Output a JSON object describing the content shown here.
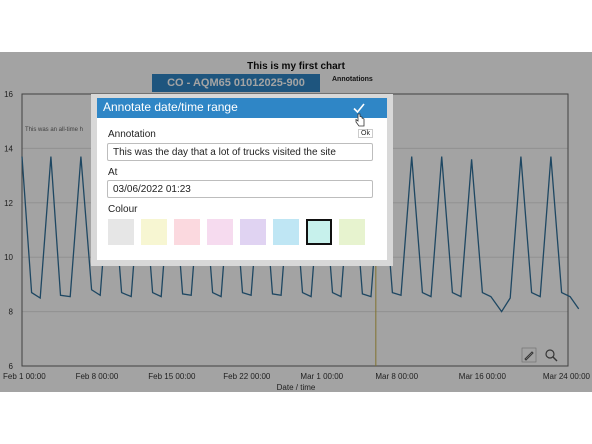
{
  "chart": {
    "title": "This is my first chart",
    "series_chip": "CO - AQM65 01012025-900",
    "annotations_link": "Annotations",
    "annotation_note": "This was an all-time h"
  },
  "chart_data": {
    "type": "line",
    "title": "This is my first chart",
    "xlabel": "Date / time",
    "ylabel": "",
    "ylim": [
      6,
      16
    ],
    "yticks": [
      6,
      8,
      10,
      12,
      14,
      16
    ],
    "xlim": [
      "2022-02-01 00:00",
      "2022-03-24 00:00"
    ],
    "xticks": [
      "Feb 1 00:00",
      "Feb 8 00:00",
      "Feb 15 00:00",
      "Feb 22 00:00",
      "Mar 1 00:00",
      "Mar 8 00:00",
      "Mar 16 00:00",
      "Mar 24 00:00"
    ],
    "xtick_days": [
      0,
      7,
      14,
      21,
      28,
      35,
      43,
      51
    ],
    "grid": true,
    "annotation_marker_day": 33.05,
    "series": [
      {
        "color": "#2f6f99",
        "points": [
          [
            0,
            13.7
          ],
          [
            0.9,
            8.7
          ],
          [
            1.7,
            8.5
          ],
          [
            2.7,
            13.7
          ],
          [
            3.6,
            8.6
          ],
          [
            4.5,
            8.55
          ],
          [
            5.5,
            13.7
          ],
          [
            6.5,
            8.8
          ],
          [
            7.3,
            8.6
          ],
          [
            8.3,
            13.7
          ],
          [
            9.3,
            8.7
          ],
          [
            10.2,
            8.55
          ],
          [
            11.2,
            13.7
          ],
          [
            12.2,
            8.7
          ],
          [
            13.0,
            8.55
          ],
          [
            14.0,
            13.7
          ],
          [
            15.0,
            8.65
          ],
          [
            15.8,
            8.6
          ],
          [
            16.8,
            13.7
          ],
          [
            17.8,
            8.7
          ],
          [
            18.6,
            8.55
          ],
          [
            19.6,
            13.7
          ],
          [
            20.6,
            8.7
          ],
          [
            21.4,
            8.6
          ],
          [
            22.4,
            13.7
          ],
          [
            23.4,
            8.65
          ],
          [
            24.2,
            8.6
          ],
          [
            25.2,
            13.7
          ],
          [
            26.2,
            8.7
          ],
          [
            27.0,
            8.55
          ],
          [
            28.0,
            13.7
          ],
          [
            29.0,
            8.7
          ],
          [
            29.8,
            8.55
          ],
          [
            30.8,
            13.7
          ],
          [
            31.8,
            8.65
          ],
          [
            32.6,
            8.55
          ],
          [
            33.6,
            13.7
          ],
          [
            34.6,
            8.7
          ],
          [
            35.4,
            8.6
          ],
          [
            36.4,
            13.7
          ],
          [
            37.4,
            8.7
          ],
          [
            38.2,
            8.55
          ],
          [
            39.2,
            13.7
          ],
          [
            40.2,
            8.7
          ],
          [
            41.0,
            8.55
          ],
          [
            42.0,
            13.6
          ],
          [
            43.0,
            8.7
          ],
          [
            43.8,
            8.55
          ],
          [
            44.8,
            8.0
          ],
          [
            45.6,
            8.5
          ],
          [
            46.6,
            13.7
          ],
          [
            47.6,
            8.7
          ],
          [
            48.4,
            8.55
          ],
          [
            49.4,
            13.7
          ],
          [
            50.4,
            8.7
          ],
          [
            51.2,
            8.55
          ],
          [
            52.0,
            8.1
          ]
        ]
      }
    ]
  },
  "modal": {
    "title": "Annotate date/time range",
    "ok_label": "Ok",
    "annotation_label": "Annotation",
    "annotation_value": "This was the day that a lot of trucks visited the site",
    "at_label": "At",
    "at_value": "03/06/2022 01:23",
    "colour_label": "Colour",
    "colours": [
      "#e6e6e6",
      "#f7f6d2",
      "#fbd9df",
      "#f6dbef",
      "#e0d3f2",
      "#bfe6f4",
      "#c7f1ec",
      "#e7f3cf"
    ],
    "selected_colour_index": 6
  },
  "toolbar": {
    "icons": [
      "pencil-icon",
      "zoom-icon"
    ]
  }
}
